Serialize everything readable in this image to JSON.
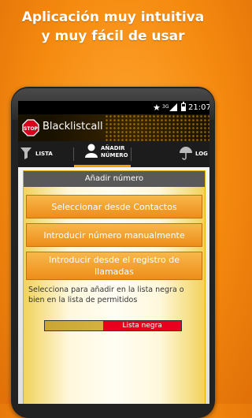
{
  "promo": {
    "line1": "Aplicación muy intuitiva",
    "line2": "y muy fácil de usar"
  },
  "statusbar": {
    "network": "3G",
    "time": "21:07",
    "icons": [
      "star-icon",
      "signal-icon",
      "battery-icon"
    ]
  },
  "app": {
    "title": "Blacklistcall",
    "logo_text": "STOP"
  },
  "tabs": [
    {
      "label": "LISTA",
      "icon": "filter-icon"
    },
    {
      "label": "AÑADIR",
      "label2": "NÚMERO",
      "icon": "add-contact-icon",
      "active": true
    },
    {
      "label": "LOG",
      "icon": "umbrella-icon"
    }
  ],
  "dialog": {
    "title": "Añadir número",
    "buttons": [
      {
        "label": "Seleccionar desde Contactos"
      },
      {
        "label": "Introducir número manualmente"
      },
      {
        "label": "Introducir desde el registro de llamadas"
      }
    ],
    "hint": "Selecciona para añadir en la lista negra o bien en la lista de permitidos",
    "toggle_label": "Lista negra",
    "toggle_selected": "Lista negra"
  },
  "colors": {
    "accent": "#f5a000",
    "button": "#ee8d1a",
    "toggle_on": "#e8001c",
    "header": "#595959"
  }
}
